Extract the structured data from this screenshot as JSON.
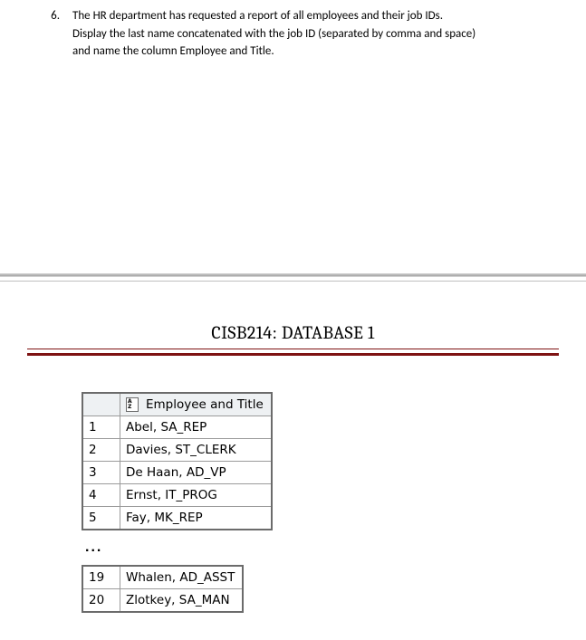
{
  "question": {
    "number": "6.",
    "text_line1": "The HR department has requested a report of all employees and their job IDs.",
    "text_line2": "Display the last name concatenated with the job ID (separated by comma and space)",
    "text_line3": "and name the column Employee and Title."
  },
  "course_title": "CISB214: DATABASE 1",
  "result_header": "Employee and Title",
  "rows_top": [
    {
      "n": "1",
      "v": "Abel, SA_REP"
    },
    {
      "n": "2",
      "v": "Davies, ST_CLERK"
    },
    {
      "n": "3",
      "v": "De Haan, AD_VP"
    },
    {
      "n": "4",
      "v": "Ernst, IT_PROG"
    },
    {
      "n": "5",
      "v": "Fay, MK_REP"
    }
  ],
  "ellipsis": "...",
  "rows_bottom": [
    {
      "n": "19",
      "v": "Whalen, AD_ASST"
    },
    {
      "n": "20",
      "v": "Zlotkey, SA_MAN"
    }
  ]
}
